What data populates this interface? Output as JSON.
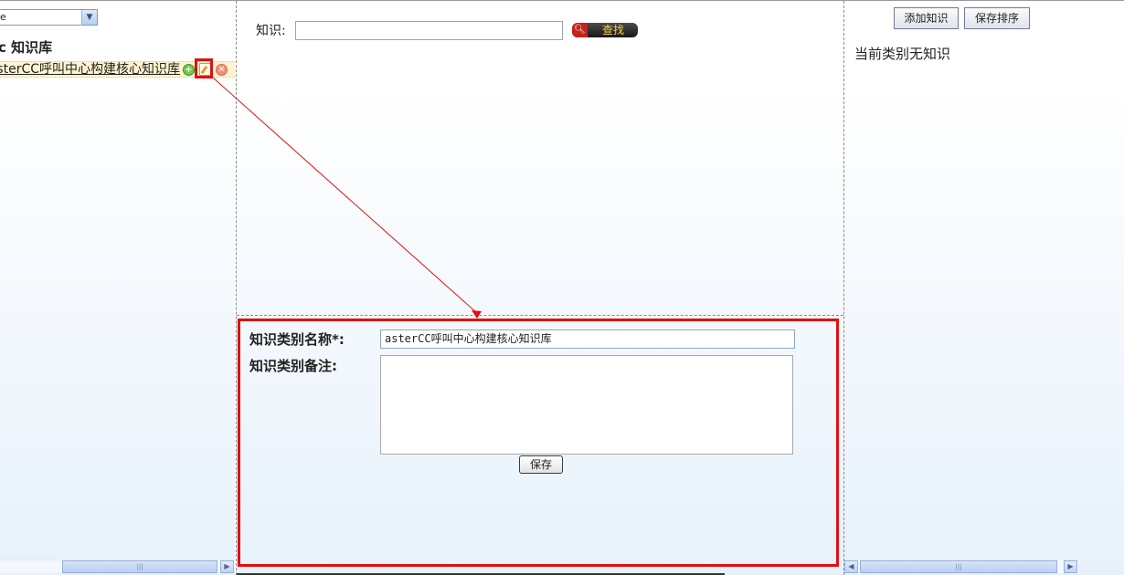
{
  "left": {
    "category_select": {
      "selected": "e"
    },
    "tree": {
      "root_label": "c 知识库",
      "node": {
        "label": "sterCC呼叫中心构建核心知识库"
      }
    }
  },
  "middle": {
    "search": {
      "label": "知识:",
      "value": "",
      "button_label": "查找"
    },
    "form": {
      "name_label": "知识类别名称*:",
      "name_value": "asterCC呼叫中心构建核心知识库",
      "memo_label": "知识类别备注:",
      "memo_value": "",
      "save_label": "保存"
    }
  },
  "right": {
    "add_button": "添加知识",
    "sort_button": "保存排序",
    "empty_message": "当前类别无知识"
  },
  "colors": {
    "highlight": "#e01010",
    "search_button_text": "#ffd23f"
  }
}
